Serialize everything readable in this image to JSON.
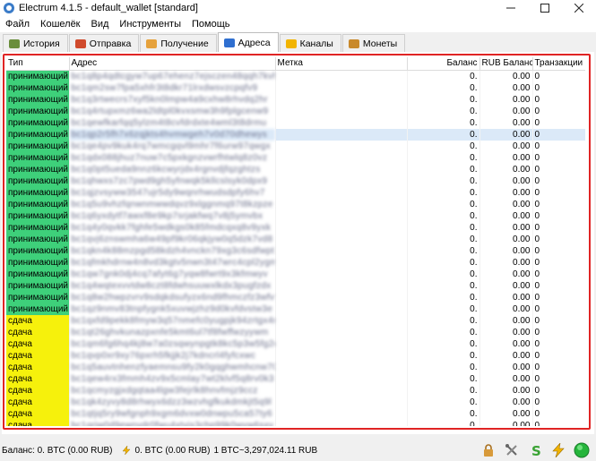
{
  "window": {
    "title": "Electrum 4.1.5  -  default_wallet  [standard]"
  },
  "menu": [
    "Файл",
    "Кошелёк",
    "Вид",
    "Инструменты",
    "Помощь"
  ],
  "tabs": [
    {
      "label": "История",
      "icon": "history-icon",
      "color": "#6a8e3c",
      "active": false
    },
    {
      "label": "Отправка",
      "icon": "send-icon",
      "color": "#d04a2c",
      "active": false
    },
    {
      "label": "Получение",
      "icon": "receive-icon",
      "color": "#e6a23c",
      "active": false
    },
    {
      "label": "Адреса",
      "icon": "addresses-icon",
      "color": "#2f6fd0",
      "active": true
    },
    {
      "label": "Каналы",
      "icon": "lightning-icon",
      "color": "#f2b400",
      "active": false
    },
    {
      "label": "Монеты",
      "icon": "coins-icon",
      "color": "#c9892b",
      "active": false
    }
  ],
  "table": {
    "headers": {
      "type": "Тип",
      "address": "Адрес",
      "label": "Метка",
      "balance": "Баланс",
      "fiat": "RUB Баланс",
      "tx": "Транзакции"
    },
    "rows": [
      {
        "type": "принимающий",
        "kind": "recv",
        "address": "bc1q8p4qdtcgyw7up67ehenz7ejsczen48qqh7kvh",
        "label": "",
        "balance": "0.",
        "fiat": "0.00",
        "tx": "0"
      },
      {
        "type": "принимающий",
        "kind": "recv",
        "address": "bc1qm2sw7fpa5xhfr3t8dkr71lrxdwsvzcpqfv9",
        "label": "",
        "balance": "0.",
        "fiat": "0.00",
        "tx": "0"
      },
      {
        "type": "принимающий",
        "kind": "recv",
        "address": "bc1q3rtwecrs7xyf5kn0lmpw4a9cxhw8rhvdq2hr",
        "label": "",
        "balance": "0.",
        "fiat": "0.00",
        "tx": "0"
      },
      {
        "type": "принимающий",
        "kind": "recv",
        "address": "bc1q4rtupxmz6wa2ldtpl0kvxsmw3h9fplgcenw9",
        "label": "",
        "balance": "0.",
        "fiat": "0.00",
        "tx": "0"
      },
      {
        "type": "принимающий",
        "kind": "recv",
        "address": "bc1qewfkarfqq5ylzm4t8cvfdrdxte4wml3t8drmu",
        "label": "",
        "balance": "0.",
        "fiat": "0.00",
        "tx": "0"
      },
      {
        "type": "принимающий",
        "kind": "recv",
        "address": "bc1qp2r5fh7x6zqjkts4hvmwgeh7v0d70dhewys",
        "label": "",
        "balance": "0.",
        "fiat": "0.00",
        "tx": "0",
        "selected": true
      },
      {
        "type": "принимающий",
        "kind": "recv",
        "address": "bc1qe4pv9kuk4rq7wmcgqvl9mhr7f6urw97qwgx",
        "label": "",
        "balance": "0.",
        "fiat": "0.00",
        "tx": "0"
      },
      {
        "type": "принимающий",
        "kind": "recv",
        "address": "bc1qdx088jhuz7nuw7c5pxkgnzvwrfhtwlq8z0vz",
        "label": "",
        "balance": "0.",
        "fiat": "0.00",
        "tx": "0"
      },
      {
        "type": "принимающий",
        "kind": "recv",
        "address": "bc1q0pt5ueda9nnz6kcwyrjdx4rgnvdjfqzghtzs",
        "label": "",
        "balance": "0.",
        "fiat": "0.00",
        "tx": "0"
      },
      {
        "type": "принимающий",
        "kind": "recv",
        "address": "bc1qhwxs7zc7pwd9gh5yfnwqk5kllcslsyk0dpx9",
        "label": "",
        "balance": "0.",
        "fiat": "0.00",
        "tx": "0"
      },
      {
        "type": "принимающий",
        "kind": "recv",
        "address": "bc1qjzvsyww3547ujr5dy9wqnrhwudsdpfy6hv7",
        "label": "",
        "balance": "0.",
        "fiat": "0.00",
        "tx": "0"
      },
      {
        "type": "принимающий",
        "kind": "recv",
        "address": "bc1q5u9vhzfqnwnmwwdqvz9xlggnmq97t8kzpze",
        "label": "",
        "balance": "0.",
        "fiat": "0.00",
        "tx": "0"
      },
      {
        "type": "принимающий",
        "kind": "recv",
        "address": "bc1q6yxdytf7awxf8e9kp7srjakfwq7v8j5ymvbx",
        "label": "",
        "balance": "0.",
        "fiat": "0.00",
        "tx": "0"
      },
      {
        "type": "принимающий",
        "kind": "recv",
        "address": "bc1q4y0qvkk7fghfe5wdkgs0k85fmdcqxq8v9yxk",
        "label": "",
        "balance": "0.",
        "fiat": "0.00",
        "tx": "0"
      },
      {
        "type": "принимающий",
        "kind": "recv",
        "address": "bc1qvj6znswmha6w49pf9kr06qkjyw0q5dzk7vd8",
        "label": "",
        "balance": "0.",
        "fiat": "0.00",
        "tx": "0"
      },
      {
        "type": "принимающий",
        "kind": "recv",
        "address": "bc1qkn4k88mzpgd58kdzh4vnckn79xg3c6sdfwpt",
        "label": "",
        "balance": "0.",
        "fiat": "0.00",
        "tx": "0"
      },
      {
        "type": "принимающий",
        "kind": "recv",
        "address": "bc1qfmkhdrnw4n8vd3kgtv5nwn3t47wrc4cpl2ygm",
        "label": "",
        "balance": "0.",
        "fiat": "0.00",
        "tx": "0"
      },
      {
        "type": "принимающий",
        "kind": "recv",
        "address": "bc1qw7gnk0dj4cq7afyt6g7yqw8fwrt9x3kfmwyv",
        "label": "",
        "balance": "0.",
        "fiat": "0.00",
        "tx": "0"
      },
      {
        "type": "принимающий",
        "kind": "recv",
        "address": "bc1q4wqtexvvtdw8czt8fdwhsuuwxlkdx3pugfzdx",
        "label": "",
        "balance": "0.",
        "fiat": "0.00",
        "tx": "0"
      },
      {
        "type": "принимающий",
        "kind": "recv",
        "address": "bc1q8w2hwpzvrv9sdqkdsufyzx6nd9fhmczfz3wfvf",
        "label": "",
        "balance": "0.",
        "fiat": "0.00",
        "tx": "0"
      },
      {
        "type": "принимающий",
        "kind": "recv",
        "address": "bc1qz9nmv83tnpfygnk5xuvwjzhz9d0kvfdvstw3e",
        "label": "",
        "balance": "0.",
        "fiat": "0.00",
        "tx": "0"
      },
      {
        "type": "сдача",
        "kind": "change",
        "address": "bc1qxfd9pekk8fmyw3q57nmefc0yugpjk94zrtgx4m",
        "label": "",
        "balance": "0.",
        "fiat": "0.00",
        "tx": "0"
      },
      {
        "type": "сдача",
        "kind": "change",
        "address": "bc1qt26ghvkunazpxnfe5kmt6ul7tf8fwffwzyywm",
        "label": "",
        "balance": "0.",
        "fiat": "0.00",
        "tx": "0"
      },
      {
        "type": "сдача",
        "kind": "change",
        "address": "bc1qm6fg6hq4kj8w7a0zsqwynpgtk8kc5p3w5fg2d",
        "label": "",
        "balance": "0.",
        "fiat": "0.00",
        "tx": "0"
      },
      {
        "type": "сдача",
        "kind": "change",
        "address": "bc1qvp0xr9xy76pxrh5fkjjk2j7kdncrl4fyfcxwc",
        "label": "",
        "balance": "0.",
        "fiat": "0.00",
        "tx": "0"
      },
      {
        "type": "сдача",
        "kind": "change",
        "address": "bc1q5auvtnhenzfyaemnsu9fy2k0gqghwmhcnw70w",
        "label": "",
        "balance": "0.",
        "fiat": "0.00",
        "tx": "0"
      },
      {
        "type": "сдача",
        "kind": "change",
        "address": "bc1qew4rx3fmmh4zv9x5cmlay7wt2klvf5q8rv0k3",
        "label": "",
        "balance": "0.",
        "fiat": "0.00",
        "tx": "0"
      },
      {
        "type": "сдача",
        "kind": "change",
        "address": "bc1qcmyzgjxdgqtaa4lgw3fejrlk8hnvfmjz9ccz",
        "label": "",
        "balance": "0.",
        "fiat": "0.00",
        "tx": "0"
      },
      {
        "type": "сдача",
        "kind": "change",
        "address": "bc1qk4zyvy8d8rhwyx6dzz3wzvhgfkukdmkjt5q9l",
        "label": "",
        "balance": "0.",
        "fiat": "0.00",
        "tx": "0"
      },
      {
        "type": "сдача",
        "kind": "change",
        "address": "bc1qtjq5ry9wfgnph9xgm6dvxw0dnwpu5ca57ty6",
        "label": "",
        "balance": "0.",
        "fiat": "0.00",
        "tx": "0"
      },
      {
        "type": "сдача",
        "kind": "change",
        "address": "bc1qrjw0d9ewnydr0fwu4xtyjs3chp99k0wyw6sxv",
        "label": "",
        "balance": "0.",
        "fiat": "0.00",
        "tx": "0"
      },
      {
        "type": "сдача",
        "kind": "change",
        "address": "bc1qdd839rkeysky4e6xf40ake7qf0fuwvyxmnqzn",
        "label": "",
        "balance": "0.",
        "fiat": "0.00",
        "tx": "0",
        "editing": true
      }
    ]
  },
  "status": {
    "balance": "Баланс: 0. BTC (0.00 RUB)",
    "lightning": "0. BTC (0.00 RUB)",
    "rate": "1 BTC~3,297,024.11 RUB",
    "icons": [
      "lock-icon",
      "tools-icon",
      "seed-icon",
      "lightning-icon",
      "network-status-icon"
    ]
  },
  "colors": {
    "receiving": "#3ed07a",
    "change": "#f6f10c",
    "highlight_frame": "#e02424",
    "selected_row": "#dbe9f8"
  }
}
